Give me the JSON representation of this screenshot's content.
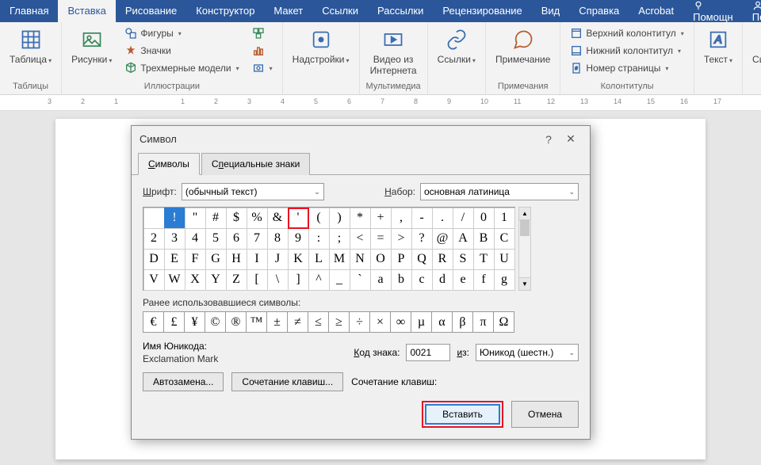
{
  "menu": {
    "tabs": [
      "Главная",
      "Вставка",
      "Рисование",
      "Конструктор",
      "Макет",
      "Ссылки",
      "Рассылки",
      "Рецензирование",
      "Вид",
      "Справка",
      "Acrobat"
    ],
    "active": "Вставка",
    "help": "Помощн",
    "share": "Поделиться"
  },
  "ribbon": {
    "groups": {
      "tables": {
        "label": "Таблицы",
        "table": "Таблица"
      },
      "illustrations": {
        "label": "Иллюстрации",
        "pictures": "Рисунки",
        "shapes": "Фигуры",
        "icons": "Значки",
        "models3d": "Трехмерные модели"
      },
      "addins": {
        "label": "",
        "addins": "Надстройки"
      },
      "media": {
        "label": "Мультимедиа",
        "video": "Видео из\nИнтернета"
      },
      "links": {
        "label": "",
        "links": "Ссылки"
      },
      "comments": {
        "label": "Примечания",
        "comment": "Примечание"
      },
      "headers": {
        "label": "Колонтитулы",
        "header": "Верхний колонтитул",
        "footer": "Нижний колонтитул",
        "pagenum": "Номер страницы"
      },
      "text": {
        "label": "",
        "text": "Текст"
      },
      "symbols": {
        "label": "",
        "symbols": "Символы"
      }
    }
  },
  "ruler_marks": [
    "3",
    "2",
    "1",
    "",
    "1",
    "2",
    "3",
    "4",
    "5",
    "6",
    "7",
    "8",
    "9",
    "10",
    "11",
    "12",
    "13",
    "14",
    "15",
    "16",
    "17"
  ],
  "dialog": {
    "title": "Символ",
    "tabs": {
      "symbols": "Символы",
      "special": "Специальные знаки"
    },
    "font_label": "Шрифт:",
    "font_value": "(обычный текст)",
    "set_label": "Набор:",
    "set_value": "основная латиница",
    "grid": [
      [
        "",
        "!",
        "\"",
        "#",
        "$",
        "%",
        "&",
        "'",
        "(",
        ")",
        "*",
        "+",
        ",",
        "-",
        ".",
        "/",
        "0",
        "1"
      ],
      [
        "2",
        "3",
        "4",
        "5",
        "6",
        "7",
        "8",
        "9",
        ":",
        ";",
        "<",
        "=",
        ">",
        "?",
        "@",
        "A",
        "B",
        "C"
      ],
      [
        "D",
        "E",
        "F",
        "G",
        "H",
        "I",
        "J",
        "K",
        "L",
        "M",
        "N",
        "O",
        "P",
        "Q",
        "R",
        "S",
        "T",
        "U"
      ],
      [
        "V",
        "W",
        "X",
        "Y",
        "Z",
        "[",
        "\\",
        "]",
        "^",
        "_",
        "`",
        "a",
        "b",
        "c",
        "d",
        "e",
        "f",
        "g"
      ]
    ],
    "selected": [
      0,
      1
    ],
    "highlighted": [
      0,
      7
    ],
    "recent_label": "Ранее использовавшиеся символы:",
    "recent": [
      "€",
      "£",
      "¥",
      "©",
      "®",
      "™",
      "±",
      "≠",
      "≤",
      "≥",
      "÷",
      "×",
      "∞",
      "µ",
      "α",
      "β",
      "π",
      "Ω"
    ],
    "unicode_name_label": "Имя Юникода:",
    "unicode_name_value": "Exclamation Mark",
    "code_label": "Код знака:",
    "code_value": "0021",
    "from_label": "из:",
    "from_value": "Юникод (шестн.)",
    "autocorrect": "Автозамена...",
    "shortcut": "Сочетание клавиш...",
    "shortcut_label": "Сочетание клавиш:",
    "insert": "Вставить",
    "cancel": "Отмена"
  }
}
